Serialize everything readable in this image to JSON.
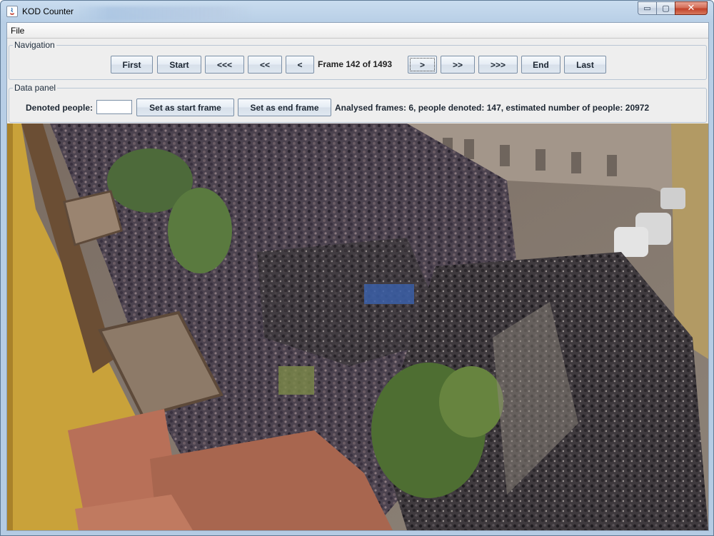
{
  "window": {
    "title": "KOD Counter",
    "minimize_glyph": "▭",
    "maximize_glyph": "▢",
    "close_glyph": "✕"
  },
  "menubar": {
    "file_label": "File"
  },
  "navigation": {
    "group_title": "Navigation",
    "buttons": {
      "first": "First",
      "start": "Start",
      "back_large": "<<<",
      "back_medium": "<<",
      "back_small": "<",
      "forward_small": ">",
      "forward_medium": ">>",
      "forward_large": ">>>",
      "end": "End",
      "last": "Last"
    },
    "frame_status": "Frame 142 of 1493"
  },
  "data_panel": {
    "group_title": "Data panel",
    "denoted_label": "Denoted people:",
    "denoted_value": "",
    "set_start_label": "Set as start frame",
    "set_end_label": "Set as end frame",
    "summary": "Analysed frames: 6, people denoted: 147, estimated number of people: 20972"
  },
  "video": {
    "description_icon": "crowd-video-frame"
  },
  "colors": {
    "title_bar": "#b8cfe6",
    "panel_bg": "#eeeeee",
    "button_border": "#7b8fa6",
    "close_red": "#c2422a"
  }
}
